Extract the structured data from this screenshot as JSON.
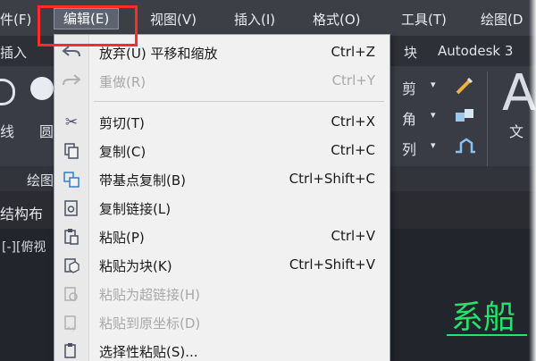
{
  "menubar": {
    "items": [
      {
        "label": "件(F)"
      },
      {
        "label": "编辑(E)"
      },
      {
        "label": "视图(V)"
      },
      {
        "label": "插入(I)"
      },
      {
        "label": "格式(O)"
      },
      {
        "label": "工具(T)"
      },
      {
        "label": "绘图(D"
      }
    ]
  },
  "ribbon": {
    "tab_left": "插入",
    "tab_right_block": "块",
    "tab_autodesk": "Autodesk 3",
    "left_line": "线",
    "left_circle": "圆",
    "draw_panel": "绘图",
    "right_trim": "剪",
    "right_fillet": "角",
    "right_array": "列",
    "right_text_big": "A",
    "right_text": "文"
  },
  "doc_tab": "结构布",
  "viewport_label": "[-][俯视",
  "canvas_text": "系船",
  "edit_menu": {
    "items": [
      {
        "label": "放弃(U) 平移和缩放",
        "shortcut": "Ctrl+Z",
        "icon": "undo-icon",
        "enabled": true
      },
      {
        "label": "重做(R)",
        "shortcut": "Ctrl+Y",
        "icon": "redo-icon",
        "enabled": false
      },
      {
        "label": "剪切(T)",
        "shortcut": "Ctrl+X",
        "icon": "scissors-icon",
        "enabled": true
      },
      {
        "label": "复制(C)",
        "shortcut": "Ctrl+C",
        "icon": "copy-icon",
        "enabled": true
      },
      {
        "label": "带基点复制(B)",
        "shortcut": "Ctrl+Shift+C",
        "icon": "copy-base-point-icon",
        "enabled": true
      },
      {
        "label": "复制链接(L)",
        "shortcut": "",
        "icon": "copy-link-icon",
        "enabled": true
      },
      {
        "label": "粘贴(P)",
        "shortcut": "Ctrl+V",
        "icon": "paste-icon",
        "enabled": true
      },
      {
        "label": "粘贴为块(K)",
        "shortcut": "Ctrl+Shift+V",
        "icon": "paste-as-block-icon",
        "enabled": true
      },
      {
        "label": "粘贴为超链接(H)",
        "shortcut": "",
        "icon": "paste-hyperlink-icon",
        "enabled": false
      },
      {
        "label": "粘贴到原坐标(D)",
        "shortcut": "",
        "icon": "paste-original-coords-icon",
        "enabled": false
      },
      {
        "label": "选择性粘贴(S)...",
        "shortcut": "",
        "icon": "paste-special-icon",
        "enabled": true
      }
    ]
  },
  "colors": {
    "highlight_box": "#ff2a2a",
    "menubar_bg": "#3c3f46",
    "menu_bg": "#f1f1f1",
    "canvas_text": "#22e36b"
  }
}
